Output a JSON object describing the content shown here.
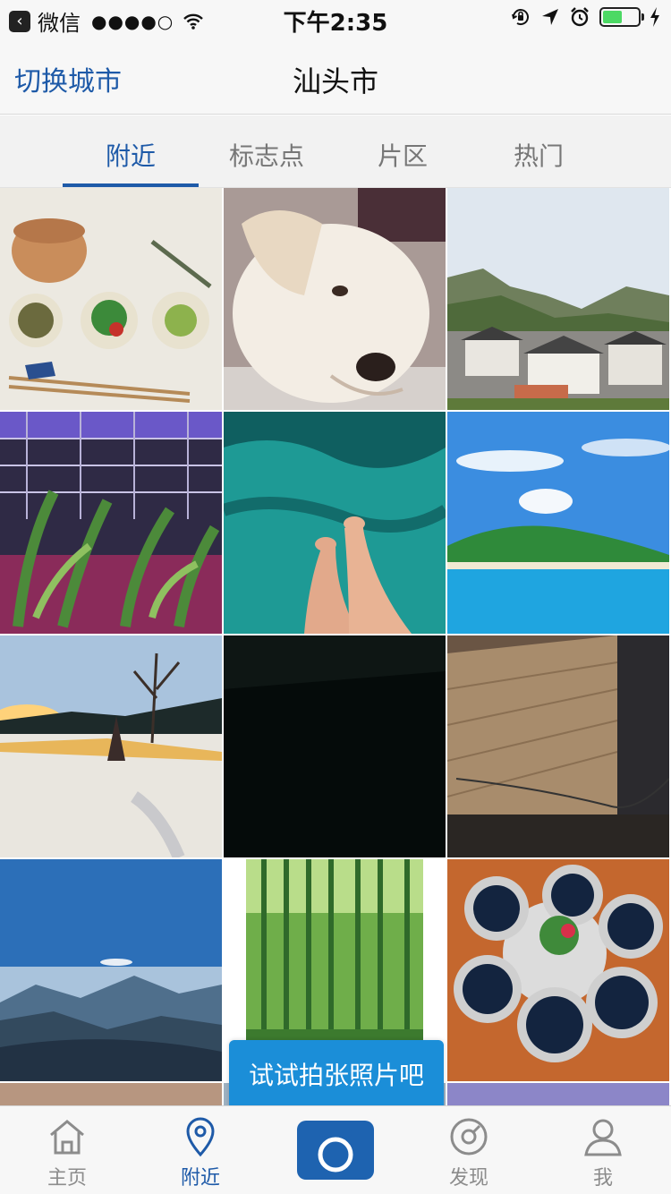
{
  "status_bar": {
    "back_glyph": "‹",
    "app": "微信",
    "signal": "●●●●○",
    "time": "下午2:35",
    "battery_level": 0.55
  },
  "nav": {
    "left_label": "切换城市",
    "title": "汕头市"
  },
  "tabs": [
    {
      "label": "附近",
      "active": true
    },
    {
      "label": "标志点",
      "active": false
    },
    {
      "label": "片区",
      "active": false
    },
    {
      "label": "热门",
      "active": false
    }
  ],
  "photos": [
    {
      "name": "food-bowls-photo"
    },
    {
      "name": "labrador-dog-photo"
    },
    {
      "name": "mountain-village-photo"
    },
    {
      "name": "greenhouse-plants-photo"
    },
    {
      "name": "feet-in-pool-photo"
    },
    {
      "name": "tropical-island-photo"
    },
    {
      "name": "snowy-sunset-photo"
    },
    {
      "name": "dark-photo"
    },
    {
      "name": "wooden-floor-photo"
    },
    {
      "name": "alpine-valley-photo"
    },
    {
      "name": "bamboo-forest-photo"
    },
    {
      "name": "indigo-dye-bowls-photo"
    }
  ],
  "hint": "试试拍张照片吧",
  "tabbar": {
    "home": "主页",
    "nearby": "附近",
    "discover": "发现",
    "me": "我"
  },
  "colors": {
    "accent": "#1e5aa8",
    "camera": "#1e63b0",
    "hint": "#1b8ed8",
    "battery": "#4cd964"
  }
}
